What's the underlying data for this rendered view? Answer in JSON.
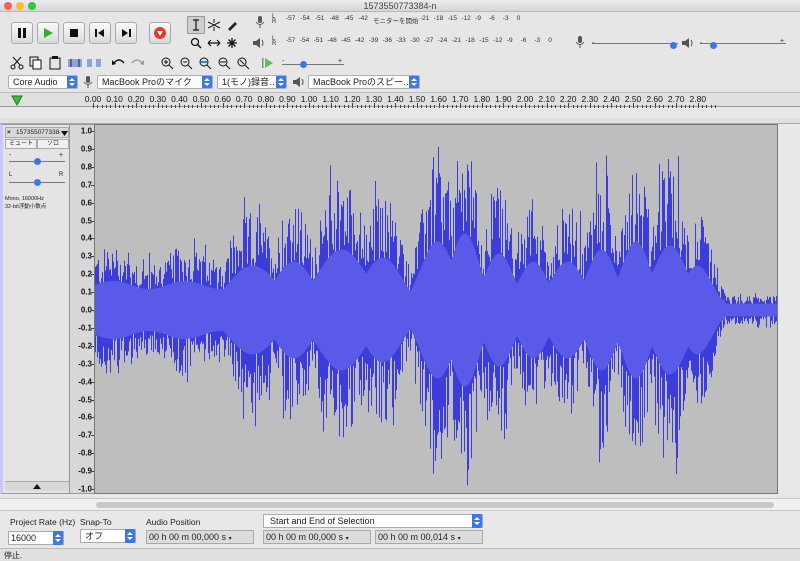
{
  "window": {
    "title": "1573550773384-n"
  },
  "transport": {
    "pause": "pause-icon",
    "play": "play-icon",
    "stop": "stop-icon",
    "skip_start": "skip-start-icon",
    "skip_end": "skip-end-icon",
    "record": "record-icon"
  },
  "meters": {
    "record_scale": [
      "-57",
      "-54",
      "-51",
      "-48",
      "-45",
      "-42"
    ],
    "monitor_label": "モニターを開始",
    "record_scale_tail": [
      "-21",
      "-18",
      "-15",
      "-12",
      "-9",
      "-6",
      "-3",
      "0"
    ],
    "play_scale": [
      "-57",
      "-54",
      "-51",
      "-48",
      "-45",
      "-42",
      "-39",
      "-36",
      "-33",
      "-30",
      "-27",
      "-24",
      "-21",
      "-18",
      "-15",
      "-12",
      "-9",
      "-6",
      "-3",
      "0"
    ],
    "L": "L",
    "R": "R"
  },
  "devices": {
    "host": "Core Audio",
    "input": "MacBook Proのマイク",
    "channels": "1(モノ)録音…",
    "output": "MacBook Proのスピー…"
  },
  "ruler": {
    "labels": [
      "0.00",
      "0.10",
      "0.20",
      "0.30",
      "0.40",
      "0.50",
      "0.60",
      "0.70",
      "0.80",
      "0.90",
      "1.00",
      "1.10",
      "1.20",
      "1.30",
      "1.40",
      "1.50",
      "1.60",
      "1.70",
      "1.80",
      "1.90",
      "2.00",
      "2.10",
      "2.20",
      "2.30",
      "2.40",
      "2.50",
      "2.60",
      "2.70",
      "2.80"
    ]
  },
  "track": {
    "name": "1573550773384-n",
    "mute": "ミュート",
    "solo": "ソロ",
    "gain_minus": "-",
    "gain_plus": "+",
    "pan_left": "L",
    "pan_right": "R",
    "info_line1": "Mono, 16000Hz",
    "info_line2": "32-bit浮動小数点"
  },
  "vscale": [
    "1.0",
    "0.9",
    "0.8",
    "0.7",
    "0.6",
    "0.5",
    "0.4",
    "0.3",
    "0.2",
    "0.1",
    "0.0",
    "-0.1",
    "-0.2",
    "-0.3",
    "-0.4",
    "-0.5",
    "-0.6",
    "-0.7",
    "-0.8",
    "-0.9",
    "-1.0"
  ],
  "bottom": {
    "project_rate_label": "Project Rate (Hz)",
    "project_rate_value": "16000",
    "snap_label": "Snap-To",
    "snap_value": "オフ",
    "audio_position_label": "Audio Position",
    "audio_position_value": "00 h 00 m 00,000 s",
    "selection_mode": "Start and End of Selection",
    "selection_start": "00 h 00 m 00,000 s",
    "selection_end": "00 h 00 m 00,014 s"
  },
  "status": {
    "text": "停止."
  },
  "colors": {
    "waveform": "#3c3cdc",
    "wave_bg": "#bebebe",
    "accent": "#3b78e7"
  }
}
